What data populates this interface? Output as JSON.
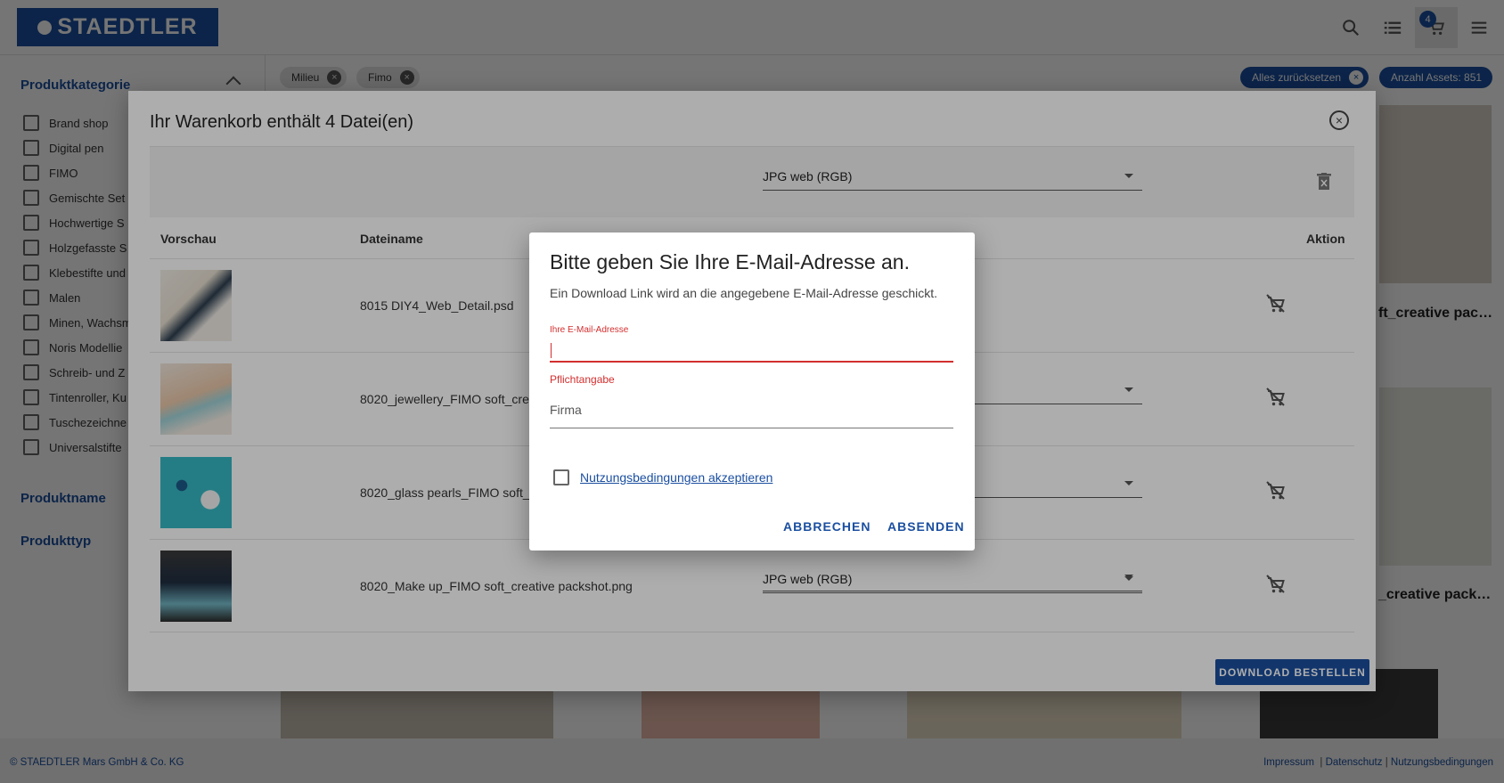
{
  "header": {
    "logo": "STAEDTLER",
    "cart_count": "4"
  },
  "sidebar": {
    "category_heading": "Produktkategorie",
    "items": [
      "Brand shop",
      "Digital pen",
      "FIMO",
      "Gemischte Set",
      "Hochwertige S",
      "Holzgefasste S",
      "Klebestifte und",
      "Malen",
      "Minen, Wachsm",
      "Noris Modellie",
      "Schreib- und Z",
      "Tintenroller, Ku",
      "Tuschezeichne",
      "Universalstifte"
    ],
    "name_heading": "Produktname",
    "type_heading": "Produkttyp"
  },
  "filters": {
    "chips": [
      "Milieu",
      "Fimo"
    ],
    "reset_label": "Alles zurücksetzen",
    "count_label": "Anzahl Assets: 851"
  },
  "background": {
    "card1_text": "ft_creative pac…",
    "card2_text": "_creative pack…"
  },
  "cart_dialog": {
    "title": "Ihr Warenkorb enthält 4 Datei(en)",
    "global_format": "JPG web (RGB)",
    "columns": {
      "preview": "Vorschau",
      "filename": "Dateiname",
      "action": "Aktion"
    },
    "rows": [
      {
        "filename": "8015 DIY4_Web_Detail.psd",
        "format": ""
      },
      {
        "filename": "8020_jewellery_FIMO soft_cre",
        "format": ""
      },
      {
        "filename": "8020_glass pearls_FIMO soft_",
        "format": ""
      },
      {
        "filename": "8020_Make up_FIMO soft_creative packshot.png",
        "format": "JPG web (RGB)"
      }
    ],
    "download_label": "DOWNLOAD BESTELLEN"
  },
  "email_dialog": {
    "title": "Bitte geben Sie Ihre E-Mail-Adresse an.",
    "subtitle": "Ein Download Link wird an die angegebene E-Mail-Adresse geschickt.",
    "email_label": "Ihre E-Mail-Adresse",
    "email_value": "",
    "email_error": "Pflichtangabe",
    "company_placeholder": "Firma",
    "terms_label": "Nutzungsbedingungen akzeptieren",
    "cancel_label": "ABBRECHEN",
    "submit_label": "ABSENDEN"
  },
  "footer": {
    "copyright": "© STAEDTLER Mars GmbH & Co. KG",
    "links": [
      "Impressum",
      "Datenschutz",
      "Nutzungsbedingungen"
    ]
  },
  "colors": {
    "brand_blue": "#1b4fa0",
    "error_red": "#d32f2f"
  }
}
